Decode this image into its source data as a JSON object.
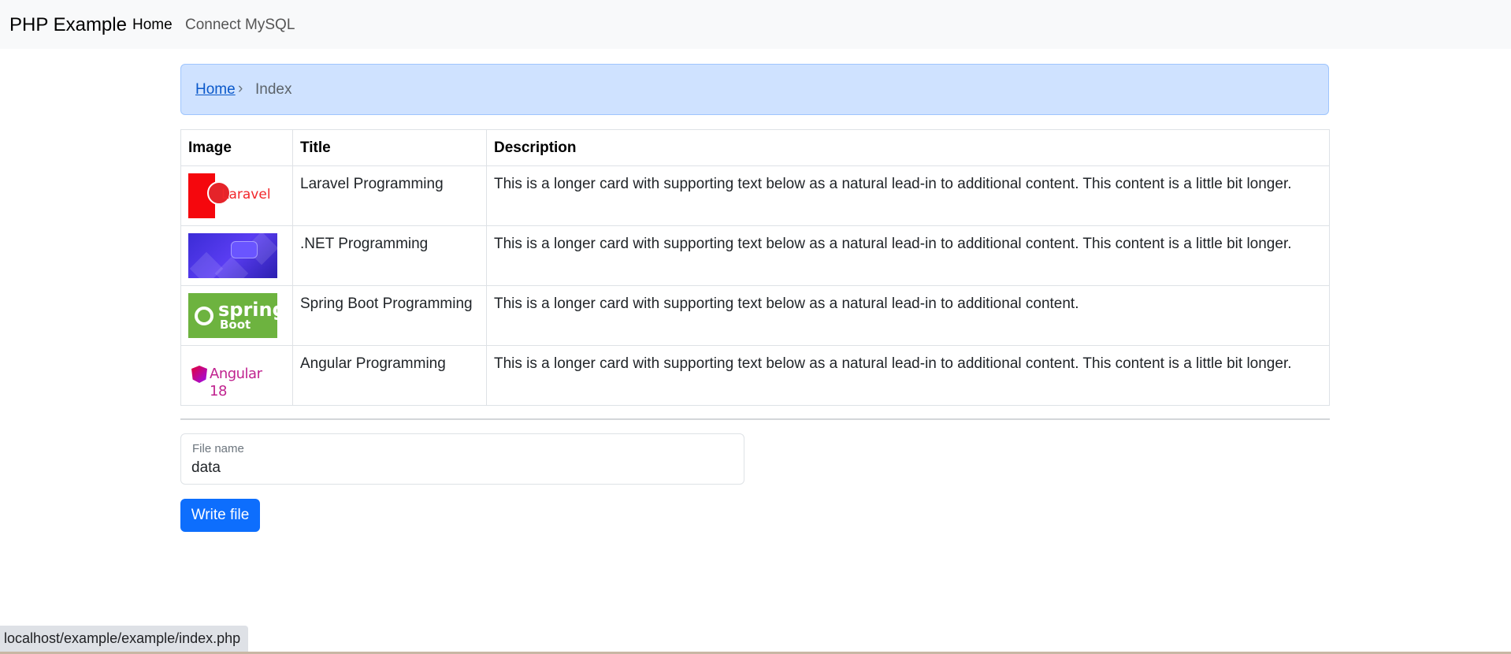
{
  "navbar": {
    "brand": "PHP Example",
    "links": [
      {
        "label": "Home",
        "active": true
      },
      {
        "label": "Connect MySQL",
        "active": false
      }
    ]
  },
  "breadcrumb": {
    "home": "Home",
    "separator": "›",
    "current": "Index"
  },
  "table": {
    "headers": [
      "Image",
      "Title",
      "Description"
    ],
    "rows": [
      {
        "image_icon": "laravel-logo-image",
        "title": "Laravel Programming",
        "description": "This is a longer card with supporting text below as a natural lead-in to additional content. This content is a little bit longer."
      },
      {
        "image_icon": "dotnet-image",
        "title": ".NET Programming",
        "description": "This is a longer card with supporting text below as a natural lead-in to additional content. This content is a little bit longer."
      },
      {
        "image_icon": "spring-boot-logo-image",
        "title": "Spring Boot Programming",
        "description": "This is a longer card with supporting text below as a natural lead-in to additional content."
      },
      {
        "image_icon": "angular-logo-image",
        "title": "Angular Programming",
        "description": "This is a longer card with supporting text below as a natural lead-in to additional content. This content is a little bit longer."
      }
    ],
    "logo_text": {
      "laravel": "Laravel",
      "spring": "spring",
      "boot": "Boot",
      "angular": "Angular 18"
    }
  },
  "form": {
    "file_label": "File name",
    "file_value": "data",
    "submit_label": "Write file"
  },
  "status_bar": {
    "url": "localhost/example/example/index.php"
  },
  "colors": {
    "primary": "#0d6efd",
    "breadcrumb_bg": "#cfe2ff",
    "navbar_bg": "#f8f9fa"
  }
}
